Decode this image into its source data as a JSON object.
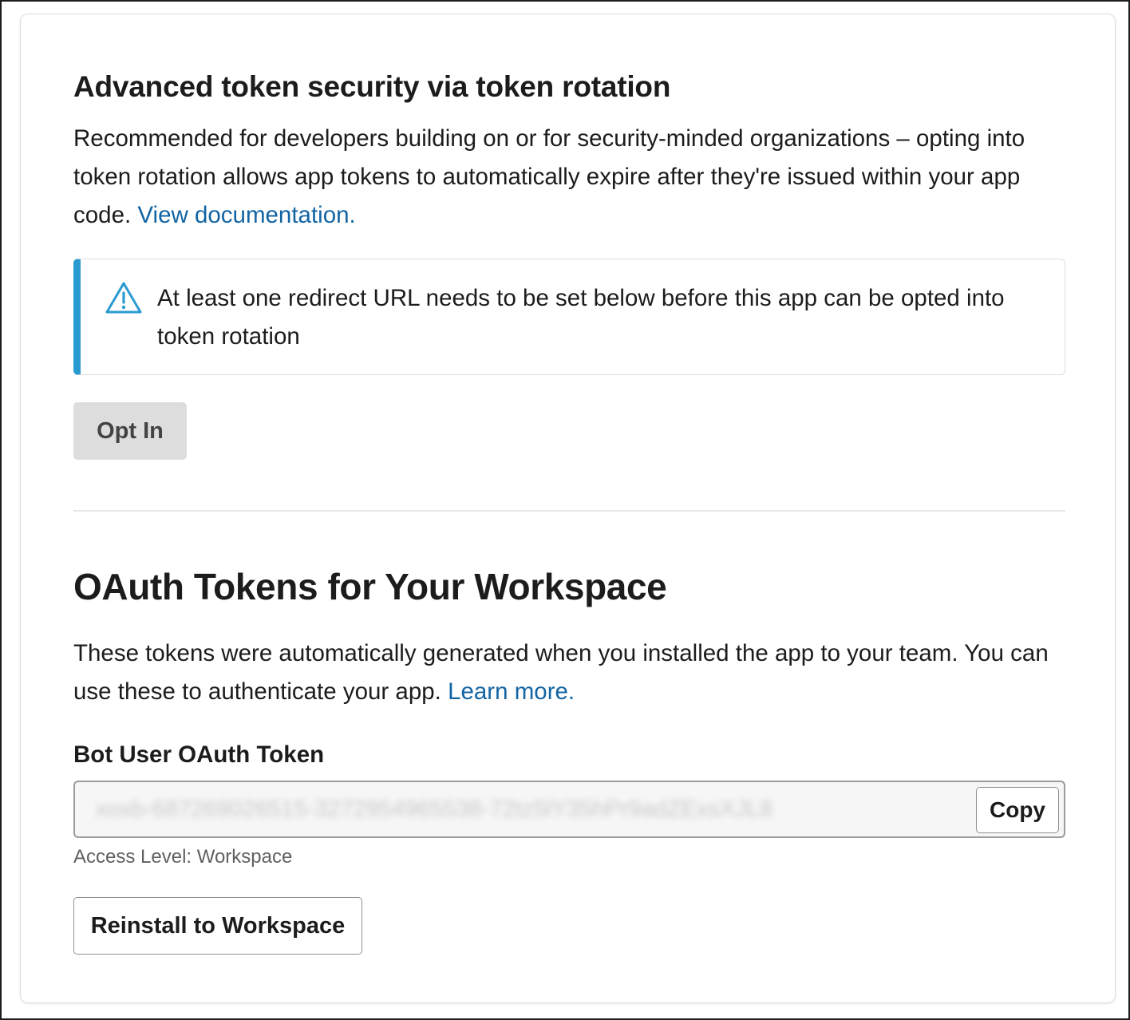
{
  "rotation": {
    "heading": "Advanced token security via token rotation",
    "description": "Recommended for developers building on or for security-minded organizations – opting into token rotation allows app tokens to automatically expire after they're issued within your app code.",
    "doc_link": "View documentation.",
    "alert_text": "At least one redirect URL needs to be set below before this app can be opted into token rotation",
    "opt_in_label": "Opt In"
  },
  "oauth": {
    "heading": "OAuth Tokens for Your Workspace",
    "description": "These tokens were automatically generated when you installed the app to your team. You can use these to authenticate your app.",
    "learn_link": "Learn more.",
    "bot_token_label": "Bot User OAuth Token",
    "bot_token_value": "xoxb-687269026515-3272954965538-72tz5lY35hPr9adZExsXJL8",
    "copy_label": "Copy",
    "access_level": "Access Level: Workspace",
    "reinstall_label": "Reinstall to Workspace"
  },
  "icons": {
    "alert": "warning-triangle-icon"
  },
  "colors": {
    "link": "#1264a3",
    "alert_accent": "#2a9bd0",
    "text": "#1d1c1d"
  }
}
